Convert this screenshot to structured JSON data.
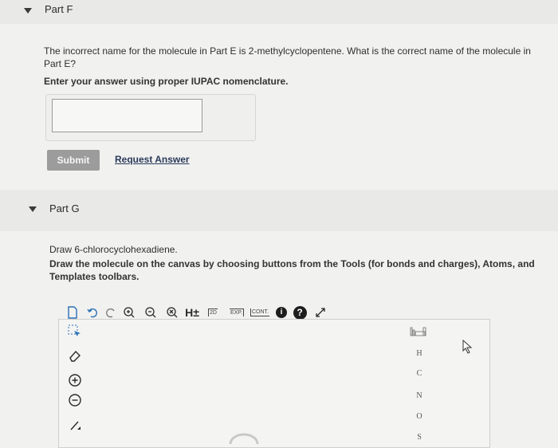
{
  "part_f": {
    "title": "Part F",
    "question": "The incorrect name for the molecule in Part E is 2-methylcyclopentene. What is the correct name of the molecule in Part E?",
    "instruction": "Enter your answer using proper IUPAC nomenclature.",
    "answer_value": "",
    "submit_label": "Submit",
    "request_label": "Request Answer"
  },
  "part_g": {
    "title": "Part G",
    "question": "Draw 6-chlorocyclohexadiene.",
    "instruction": "Draw the molecule on the canvas by choosing buttons from the Tools (for bonds and charges), Atoms, and Templates toolbars."
  },
  "toolbar": {
    "h_label": "H±",
    "twod_label": "2D",
    "exp_label": "EXP.",
    "cont_label": "CONT.",
    "info_label": "i",
    "help_label": "?",
    "icons": [
      "new-file-icon",
      "undo-icon",
      "redo-icon",
      "zoom-in-icon",
      "zoom-out-icon",
      "clear-icon",
      "h-charge-icon",
      "2d-icon",
      "expand-icon",
      "contract-icon",
      "info-icon",
      "help-icon",
      "fullscreen-icon"
    ]
  },
  "atoms": [
    "H",
    "C",
    "N",
    "O",
    "S"
  ],
  "colors": {
    "background": "#f1f1f0",
    "band": "#e9e9e8",
    "submit": "#9c9c9c",
    "link": "#2a3a5a"
  }
}
